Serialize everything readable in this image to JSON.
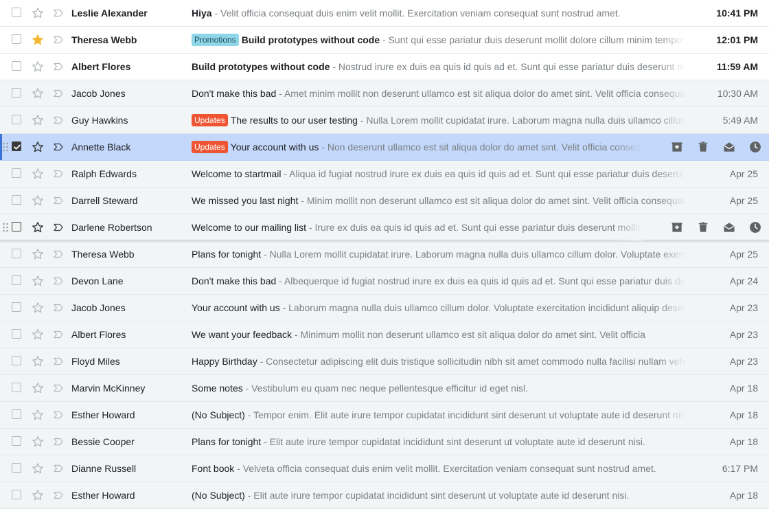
{
  "rows": [
    {
      "sender": "Leslie Alexander",
      "badge": null,
      "subject": "Hiya",
      "snippet": " - Velit officia consequat duis enim velit mollit. Exercitation veniam consequat sunt nostrud amet.",
      "date": "10:41 PM",
      "unread": true,
      "starred": false,
      "checked": false,
      "state": "normal",
      "content_width": 720
    },
    {
      "sender": "Theresa Webb",
      "badge": "Promotions",
      "subject": "Build prototypes without code",
      "snippet": " - Sunt qui esse pariatur duis deserunt mollit dolore cillum minim tempor enim",
      "date": "12:01 PM",
      "unread": true,
      "starred": true,
      "checked": false,
      "state": "normal",
      "content_width": 720
    },
    {
      "sender": "Albert Flores",
      "badge": null,
      "subject": "Build prototypes without code",
      "snippet": " - Nostrud irure ex duis ea quis id quis ad et. Sunt qui esse pariatur duis deserunt mollit",
      "date": "11:59 AM",
      "unread": true,
      "starred": false,
      "checked": false,
      "state": "normal",
      "content_width": 720
    },
    {
      "sender": "Jacob Jones",
      "badge": null,
      "subject": "Don't make this bad",
      "snippet": " - Amet minim mollit non deserunt ullamco est sit aliqua dolor do amet sint. Velit officia consequat",
      "date": "10:30 AM",
      "unread": false,
      "starred": false,
      "checked": false,
      "state": "normal",
      "content_width": 720
    },
    {
      "sender": "Guy Hawkins",
      "badge": "Updates",
      "subject": "The results to our user testing",
      "snippet": " - Nulla Lorem mollit cupidatat irure. Laborum magna nulla duis ullamco cillum",
      "date": "5:49 AM",
      "unread": false,
      "starred": false,
      "checked": false,
      "state": "normal",
      "content_width": 720
    },
    {
      "sender": "Annette Black",
      "badge": "Updates",
      "subject": "Your account with us",
      "snippet": " - Non deserunt ullamco est sit aliqua dolor do amet sint. Velit officia consequat",
      "date": "",
      "unread": false,
      "starred": false,
      "checked": true,
      "state": "selected",
      "content_width": 656
    },
    {
      "sender": "Ralph Edwards",
      "badge": null,
      "subject": "Welcome to startmail",
      "snippet": " - Aliqua id fugiat nostrud irure ex duis ea quis id quis ad et. Sunt qui esse pariatur duis deserunt",
      "date": "Apr 25",
      "unread": false,
      "starred": false,
      "checked": false,
      "state": "normal",
      "content_width": 720
    },
    {
      "sender": "Darrell Steward",
      "badge": null,
      "subject": "We missed you last night",
      "snippet": " - Minim mollit non deserunt ullamco est sit aliqua dolor do amet sint. Velit officia consequat",
      "date": "Apr 25",
      "unread": false,
      "starred": false,
      "checked": false,
      "state": "normal",
      "content_width": 720
    },
    {
      "sender": "Darlene Robertson",
      "badge": null,
      "subject": "Welcome to our mailing list",
      "snippet": " - Irure ex duis ea quis id quis ad et. Sunt qui esse pariatur duis deserunt mollit",
      "date": "",
      "unread": false,
      "starred": false,
      "checked": false,
      "state": "hovered",
      "content_width": 656
    },
    {
      "sender": "Theresa Webb",
      "badge": null,
      "subject": "Plans for tonight",
      "snippet": " - Nulla Lorem mollit cupidatat irure. Laborum magna nulla duis ullamco cillum dolor. Voluptate exercitation",
      "date": "Apr 25",
      "unread": false,
      "starred": false,
      "checked": false,
      "state": "normal",
      "content_width": 720
    },
    {
      "sender": "Devon Lane",
      "badge": null,
      "subject": "Don't make this bad",
      "snippet": " - Albequerque id fugiat nostrud irure ex duis ea quis id quis ad et. Sunt qui esse pariatur duis deserunt",
      "date": "Apr 24",
      "unread": false,
      "starred": false,
      "checked": false,
      "state": "normal",
      "content_width": 720
    },
    {
      "sender": "Jacob Jones",
      "badge": null,
      "subject": "Your account with us",
      "snippet": " - Laborum magna nulla duis ullamco cillum dolor. Voluptate exercitation incididunt aliquip deserunt",
      "date": "Apr 23",
      "unread": false,
      "starred": false,
      "checked": false,
      "state": "normal",
      "content_width": 720
    },
    {
      "sender": "Albert Flores",
      "badge": null,
      "subject": "We want your feedback",
      "snippet": " - Minimum mollit non deserunt ullamco est sit aliqua dolor do amet sint. Velit officia",
      "date": "Apr 23",
      "unread": false,
      "starred": false,
      "checked": false,
      "state": "normal",
      "content_width": 720
    },
    {
      "sender": "Floyd Miles",
      "badge": null,
      "subject": "Happy Birthday",
      "snippet": " - Consectetur adipiscing elit duis tristique sollicitudin nibh sit amet commodo nulla facilisi nullam vehicula",
      "date": "Apr 23",
      "unread": false,
      "starred": false,
      "checked": false,
      "state": "normal",
      "content_width": 720
    },
    {
      "sender": "Marvin McKinney",
      "badge": null,
      "subject": "Some notes",
      "snippet": " - Vestibulum eu quam nec neque pellentesque efficitur id eget nisl.",
      "date": "Apr 18",
      "unread": false,
      "starred": false,
      "checked": false,
      "state": "normal",
      "content_width": 720
    },
    {
      "sender": "Esther Howard",
      "badge": null,
      "subject": "(No Subject)",
      "snippet": " - Tempor enim. Elit aute irure tempor cupidatat incididunt sint deserunt ut voluptate aute id deserunt nisi.",
      "date": "Apr 18",
      "unread": false,
      "starred": false,
      "checked": false,
      "state": "normal",
      "content_width": 720
    },
    {
      "sender": "Bessie Cooper",
      "badge": null,
      "subject": "Plans for tonight",
      "snippet": " - Elit aute irure tempor cupidatat incididunt sint deserunt ut voluptate aute id deserunt nisi.",
      "date": "Apr 18",
      "unread": false,
      "starred": false,
      "checked": false,
      "state": "normal",
      "content_width": 720
    },
    {
      "sender": "Dianne Russell",
      "badge": null,
      "subject": "Font book",
      "snippet": " - Velveta officia consequat duis enim velit mollit. Exercitation veniam consequat sunt nostrud amet.",
      "date": "6:17 PM",
      "unread": false,
      "starred": false,
      "checked": false,
      "state": "normal",
      "content_width": 720
    },
    {
      "sender": "Esther Howard",
      "badge": null,
      "subject": "(No Subject)",
      "snippet": " - Elit aute irure tempor cupidatat incididunt sint deserunt ut voluptate aute id deserunt nisi.",
      "date": "Apr 18",
      "unread": false,
      "starred": false,
      "checked": false,
      "state": "normal",
      "content_width": 720
    }
  ],
  "row_actions": [
    {
      "name": "archive-icon"
    },
    {
      "name": "delete-icon"
    },
    {
      "name": "mark-as-read-icon"
    },
    {
      "name": "snooze-icon"
    }
  ],
  "colors": {
    "read_row": "#f2f5f5",
    "unread_row": "#ffffff",
    "selected_row": "#c3d8fa",
    "selection_accent": "#3b73d9",
    "star_active": "#f5b731",
    "badge_promotions": "#8ed6e8",
    "badge_updates": "#ef5533"
  }
}
